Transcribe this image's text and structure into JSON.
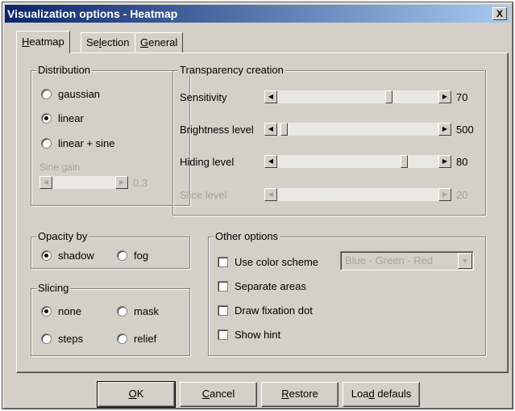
{
  "window": {
    "title": "Visualization options - Heatmap",
    "close_label": "X"
  },
  "tabs": [
    {
      "label": "Heatmap",
      "mnemonic": "H"
    },
    {
      "label": "Selection",
      "mnemonic": "l"
    },
    {
      "label": "General",
      "mnemonic": "G"
    }
  ],
  "distribution": {
    "label": "Distribution",
    "options": [
      "gaussian",
      "linear",
      "linear + sine"
    ],
    "selected": "linear",
    "sine_gain": {
      "label": "Sine gain",
      "value": "0.3",
      "enabled": false,
      "level": 0.0
    }
  },
  "transparency": {
    "label": "Transparency creation",
    "sliders": [
      {
        "label": "Sensitivity",
        "value": "70",
        "enabled": true,
        "level": 0.7
      },
      {
        "label": "Brightness level",
        "value": "500",
        "enabled": true,
        "level": 0.02
      },
      {
        "label": "Hiding level",
        "value": "80",
        "enabled": true,
        "level": 0.8
      },
      {
        "label": "Slice level",
        "value": "20",
        "enabled": false,
        "level": 0.0
      }
    ]
  },
  "opacity": {
    "label": "Opacity by",
    "options": [
      "shadow",
      "fog"
    ],
    "selected": "shadow"
  },
  "slicing": {
    "label": "Slicing",
    "options": [
      "none",
      "mask",
      "steps",
      "relief"
    ],
    "selected": "none"
  },
  "other_options": {
    "label": "Other options",
    "use_color_scheme": {
      "label": "Use color scheme",
      "checked": false
    },
    "color_scheme": {
      "value": "Blue - Green - Red",
      "enabled": false
    },
    "separate_areas": {
      "label": "Separate areas",
      "checked": false
    },
    "draw_fixation_dot": {
      "label": "Draw fixation dot",
      "checked": false
    },
    "show_hint": {
      "label": "Show hint",
      "checked": false
    }
  },
  "buttons": [
    {
      "label": "OK",
      "mnemonic": "O"
    },
    {
      "label": "Cancel",
      "mnemonic": "C"
    },
    {
      "label": "Restore",
      "mnemonic": "R"
    },
    {
      "label": "Load defauls",
      "mnemonic": "d"
    }
  ]
}
